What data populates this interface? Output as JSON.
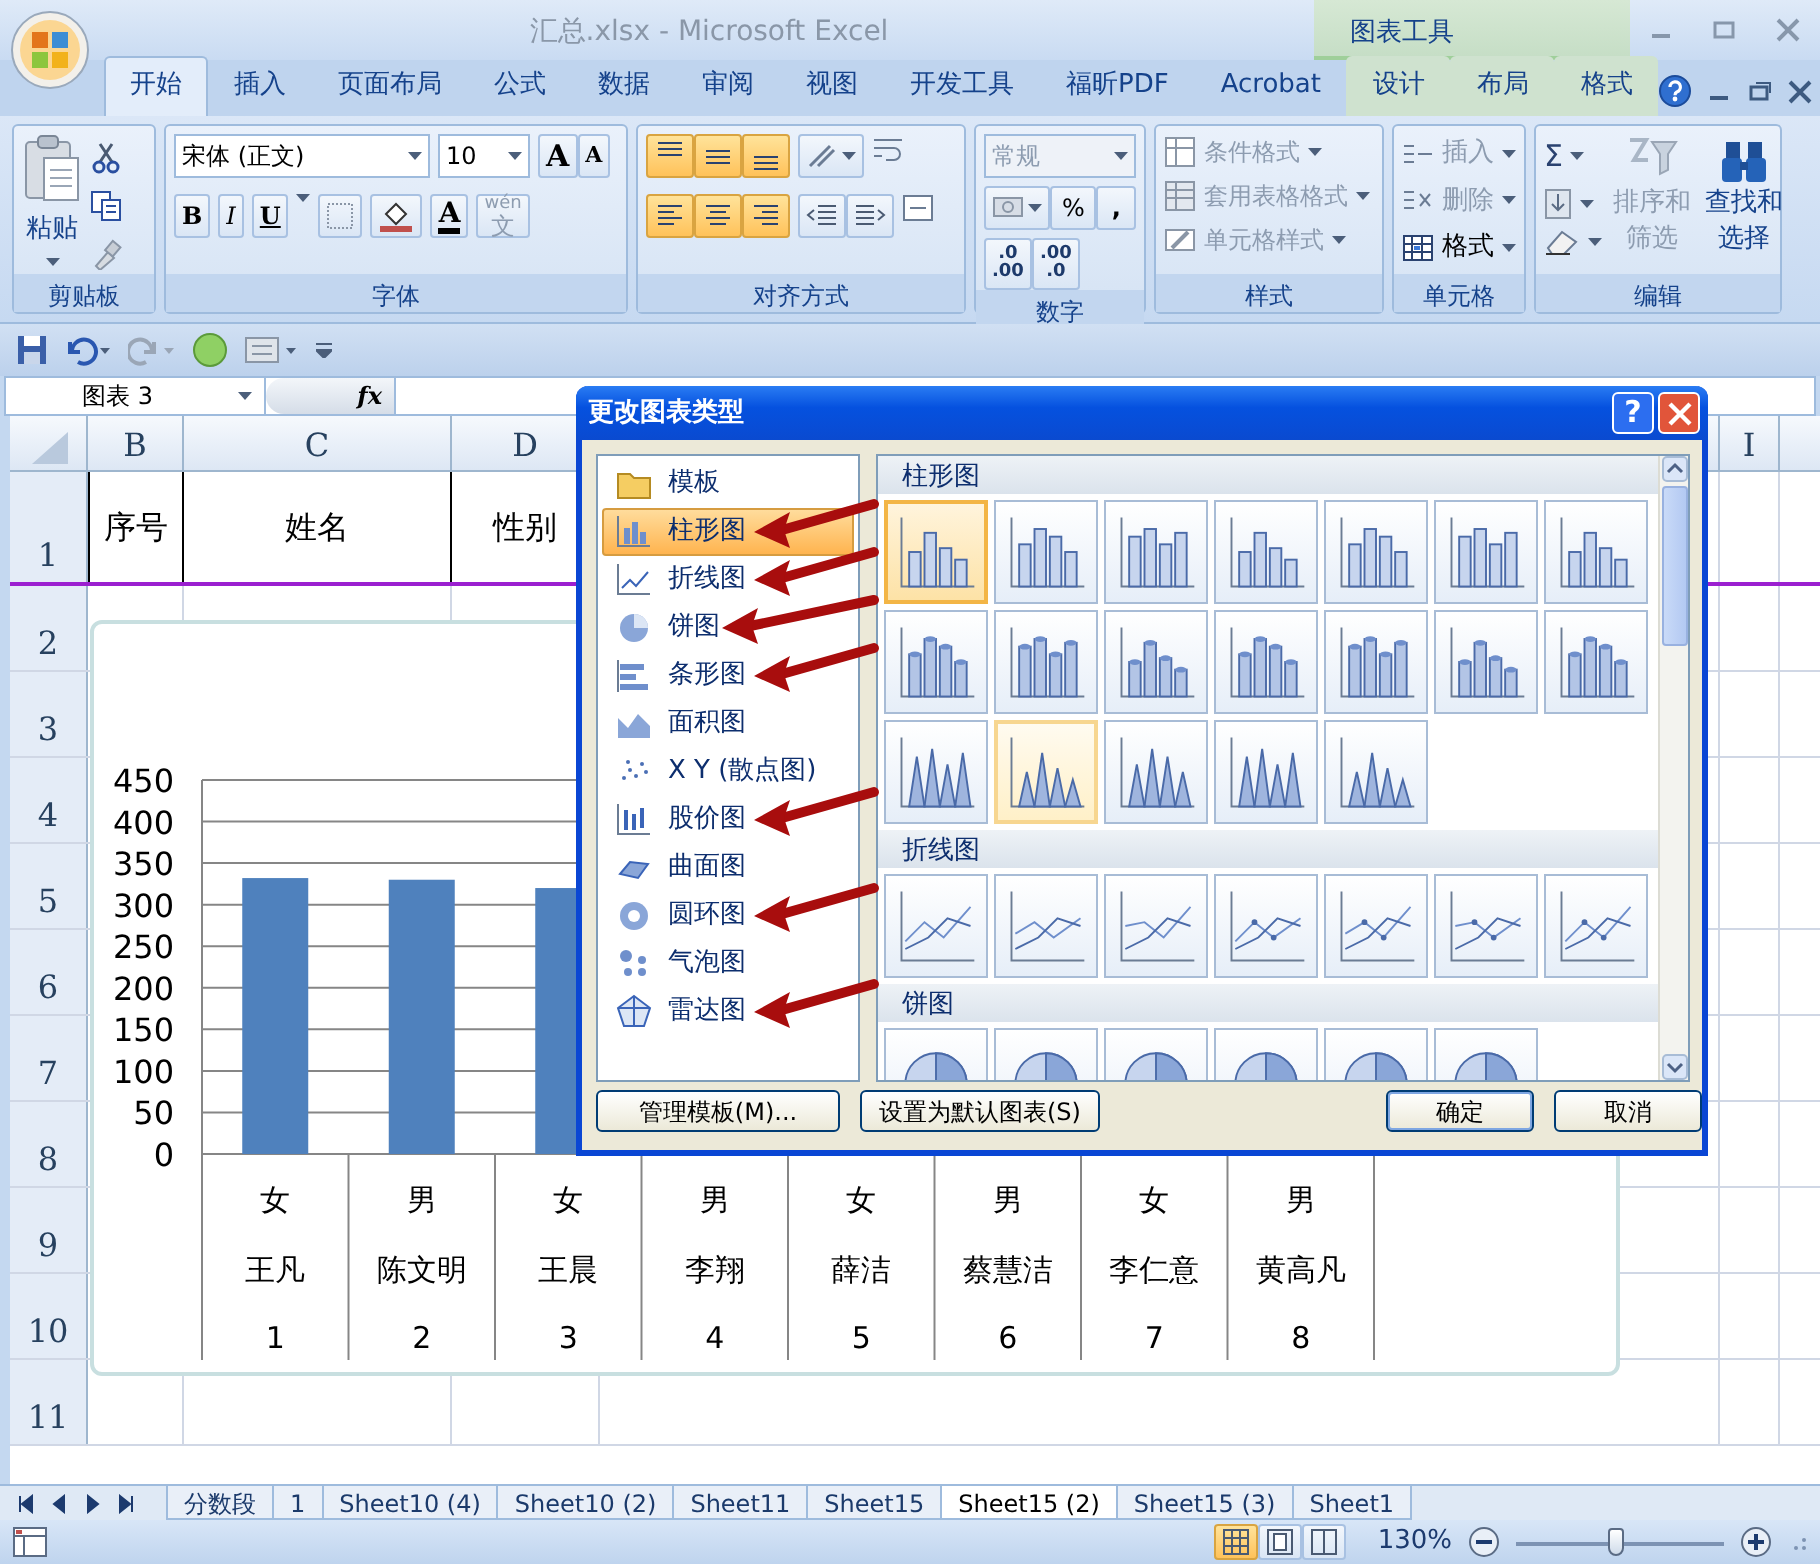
{
  "window": {
    "title": "汇总.xlsx - Microsoft Excel",
    "context_tab_group": "图表工具"
  },
  "ribbon_tabs": [
    {
      "label": "开始",
      "selected": true,
      "contextual": false
    },
    {
      "label": "插入",
      "selected": false,
      "contextual": false
    },
    {
      "label": "页面布局",
      "selected": false,
      "contextual": false
    },
    {
      "label": "公式",
      "selected": false,
      "contextual": false
    },
    {
      "label": "数据",
      "selected": false,
      "contextual": false
    },
    {
      "label": "审阅",
      "selected": false,
      "contextual": false
    },
    {
      "label": "视图",
      "selected": false,
      "contextual": false
    },
    {
      "label": "开发工具",
      "selected": false,
      "contextual": false
    },
    {
      "label": "福昕PDF",
      "selected": false,
      "contextual": false
    },
    {
      "label": "Acrobat",
      "selected": false,
      "contextual": false
    },
    {
      "label": "设计",
      "selected": false,
      "contextual": true
    },
    {
      "label": "布局",
      "selected": false,
      "contextual": true
    },
    {
      "label": "格式",
      "selected": false,
      "contextual": true
    }
  ],
  "ribbon": {
    "clipboard": {
      "label": "剪贴板",
      "paste": "粘贴"
    },
    "font": {
      "label": "字体",
      "font_name": "宋体 (正文)",
      "font_size": "10",
      "grow": "A",
      "shrink": "A",
      "bold": "B",
      "italic": "I",
      "underline": "U",
      "font_color": "A",
      "phonetic_top": "wén",
      "phonetic_bottom": "文"
    },
    "alignment": {
      "label": "对齐方式",
      "vertical_buttons": [
        {
          "highlighted": true
        },
        {
          "highlighted": true
        },
        {
          "highlighted": true
        }
      ],
      "horizontal_buttons": [
        {
          "highlighted": true
        },
        {
          "highlighted": true
        },
        {
          "highlighted": true
        }
      ]
    },
    "number": {
      "label": "数字",
      "format": "常规",
      "format_disabled": true,
      "percent": "%",
      "comma": ",",
      "increase_decimal": [
        ".0",
        ".00"
      ],
      "decrease_decimal": [
        ".00",
        ".0"
      ]
    },
    "styles": {
      "label": "样式",
      "items": [
        {
          "label": "条件格式",
          "disabled": true
        },
        {
          "label": "套用表格格式",
          "disabled": true
        },
        {
          "label": "单元格样式",
          "disabled": true
        }
      ]
    },
    "cells": {
      "label": "单元格",
      "items": [
        {
          "label": "插入",
          "disabled": true
        },
        {
          "label": "删除",
          "disabled": true
        },
        {
          "label": "格式",
          "disabled": false
        }
      ]
    },
    "editing": {
      "label": "编辑",
      "autosum": "Σ",
      "big_buttons": [
        {
          "label": "排序和筛选",
          "disabled": true
        },
        {
          "label": "查找和选择",
          "disabled": false
        }
      ]
    }
  },
  "formula_bar": {
    "name_box": "图表 3",
    "fx": "fx"
  },
  "sheet": {
    "columns": [
      "B",
      "C",
      "D",
      "I"
    ],
    "rows": [
      "1",
      "2",
      "3",
      "4",
      "5",
      "6",
      "7",
      "8",
      "9",
      "10",
      "11"
    ],
    "row_1_cells": [
      "序号",
      "姓名",
      "性别"
    ]
  },
  "chart": {
    "chart_data": {
      "type": "bar",
      "categories": [
        "1",
        "2",
        "3",
        "4",
        "5",
        "6",
        "7",
        "8"
      ],
      "series": [
        {
          "color": "#4f81bd",
          "values": [
            332,
            330,
            320,
            null,
            null,
            null,
            null,
            null
          ]
        }
      ],
      "grid": true,
      "ylim": [
        0,
        450
      ],
      "yticks": [
        0,
        50,
        100,
        150,
        200,
        250,
        300,
        350,
        400,
        450
      ]
    },
    "category_sex": [
      "女",
      "男",
      "女",
      "男",
      "女",
      "男",
      "女",
      "男"
    ],
    "category_name": [
      "王凡",
      "陈文明",
      "王晨",
      "李翔",
      "薛洁",
      "蔡慧洁",
      "李仁意",
      "黄高凡"
    ]
  },
  "dialog": {
    "title": "更改图表类型",
    "help": "?",
    "types": [
      {
        "label": "模板",
        "selected": false
      },
      {
        "label": "柱形图",
        "selected": true
      },
      {
        "label": "折线图",
        "selected": false
      },
      {
        "label": "饼图",
        "selected": false
      },
      {
        "label": "条形图",
        "selected": false
      },
      {
        "label": "面积图",
        "selected": false
      },
      {
        "label": "X Y (散点图)",
        "selected": false
      },
      {
        "label": "股价图",
        "selected": false
      },
      {
        "label": "曲面图",
        "selected": false
      },
      {
        "label": "圆环图",
        "selected": false
      },
      {
        "label": "气泡图",
        "selected": false
      },
      {
        "label": "雷达图",
        "selected": false
      }
    ],
    "sections": [
      {
        "title": "柱形图",
        "kind": "column",
        "thumbnails": [
          {
            "selected": true,
            "hovered": false
          },
          {
            "selected": false,
            "hovered": false
          },
          {
            "selected": false,
            "hovered": false
          },
          {
            "selected": false,
            "hovered": false
          },
          {
            "selected": false,
            "hovered": false
          },
          {
            "selected": false,
            "hovered": false
          },
          {
            "selected": false,
            "hovered": false
          },
          {
            "selected": false,
            "hovered": false
          },
          {
            "selected": false,
            "hovered": false
          },
          {
            "selected": false,
            "hovered": false
          },
          {
            "selected": false,
            "hovered": false
          },
          {
            "selected": false,
            "hovered": false
          },
          {
            "selected": false,
            "hovered": false
          },
          {
            "selected": false,
            "hovered": false
          },
          {
            "selected": false,
            "hovered": false
          },
          {
            "selected": false,
            "hovered": true
          },
          {
            "selected": false,
            "hovered": false
          },
          {
            "selected": false,
            "hovered": false
          },
          {
            "selected": false,
            "hovered": false
          }
        ]
      },
      {
        "title": "折线图",
        "kind": "line",
        "thumbnails": [
          {
            "selected": false,
            "hovered": false
          },
          {
            "selected": false,
            "hovered": false
          },
          {
            "selected": false,
            "hovered": false
          },
          {
            "selected": false,
            "hovered": false
          },
          {
            "selected": false,
            "hovered": false
          },
          {
            "selected": false,
            "hovered": false
          },
          {
            "selected": false,
            "hovered": false
          }
        ]
      },
      {
        "title": "饼图",
        "kind": "pie",
        "thumbnails": [
          {
            "selected": false,
            "hovered": false
          },
          {
            "selected": false,
            "hovered": false
          },
          {
            "selected": false,
            "hovered": false
          },
          {
            "selected": false,
            "hovered": false
          },
          {
            "selected": false,
            "hovered": false
          },
          {
            "selected": false,
            "hovered": false
          }
        ]
      }
    ],
    "buttons": [
      {
        "label": "管理模板(M)...",
        "kind": "left",
        "default": false
      },
      {
        "label": "设置为默认图表(S)",
        "kind": "left",
        "default": false
      },
      {
        "label": "确定",
        "kind": "right",
        "default": true
      },
      {
        "label": "取消",
        "kind": "right",
        "default": false
      }
    ]
  },
  "sheet_tabs": [
    {
      "label": "分数段",
      "selected": false
    },
    {
      "label": "1",
      "selected": false
    },
    {
      "label": "Sheet10 (4)",
      "selected": false
    },
    {
      "label": "Sheet10 (2)",
      "selected": false
    },
    {
      "label": "Sheet11",
      "selected": false
    },
    {
      "label": "Sheet15",
      "selected": false
    },
    {
      "label": "Sheet15 (2)",
      "selected": true
    },
    {
      "label": "Sheet15 (3)",
      "selected": false
    },
    {
      "label": "Sheet1",
      "selected": false
    }
  ],
  "status_bar": {
    "views": [
      {
        "selected": true
      },
      {
        "selected": false
      },
      {
        "selected": false
      }
    ],
    "zoom": "130%",
    "zoom_slider": {
      "level": 0.48
    }
  }
}
